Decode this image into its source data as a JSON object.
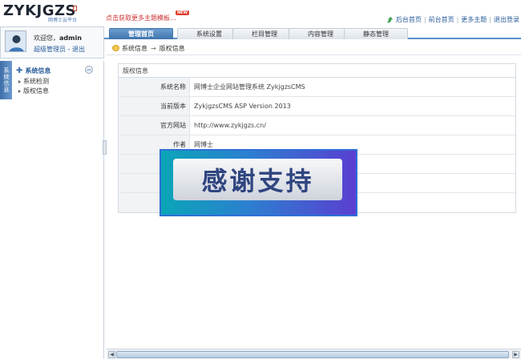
{
  "header": {
    "logo": "ZYKJGZS",
    "logo_sub": "网博士云平台",
    "promo": "点击获取更多主题模板...",
    "promo_badge": "NEW",
    "links": [
      "后台首页",
      "前台首页",
      "更多主题",
      "退出登录"
    ]
  },
  "tabs": [
    "管理首页",
    "系统设置",
    "栏目管理",
    "内容管理",
    "静态管理"
  ],
  "user": {
    "welcome_prefix": "欢迎您，",
    "name": "admin",
    "role_link": "超级管理员",
    "logout_link": "退出",
    "link_sep": "-"
  },
  "sidebar": {
    "tab_label": "系统信息",
    "section_title": "系统信息",
    "items": [
      "系统检测",
      "版权信息"
    ]
  },
  "breadcrumb": {
    "root": "系统信息",
    "arrow": "→",
    "current": "版权信息"
  },
  "panel": {
    "title": "版权信息",
    "rows": [
      {
        "label": "系统名称",
        "value": "网博士企业网站管理系统 ZykjgzsCMS"
      },
      {
        "label": "当前版本",
        "value": "ZykjgzsCMS ASP Version 2013"
      },
      {
        "label": "官方网站",
        "value": "http://www.zykjgzs.cn/"
      },
      {
        "label": "作者",
        "value": "网博士"
      },
      {
        "label": "",
        "value": ""
      },
      {
        "label": "",
        "value": ""
      },
      {
        "label": "",
        "value": ""
      }
    ]
  },
  "overlay": {
    "text": "感谢支持"
  },
  "colors": {
    "accent": "#3f74ad",
    "link": "#2a5d9b",
    "promo": "#cc3333"
  }
}
